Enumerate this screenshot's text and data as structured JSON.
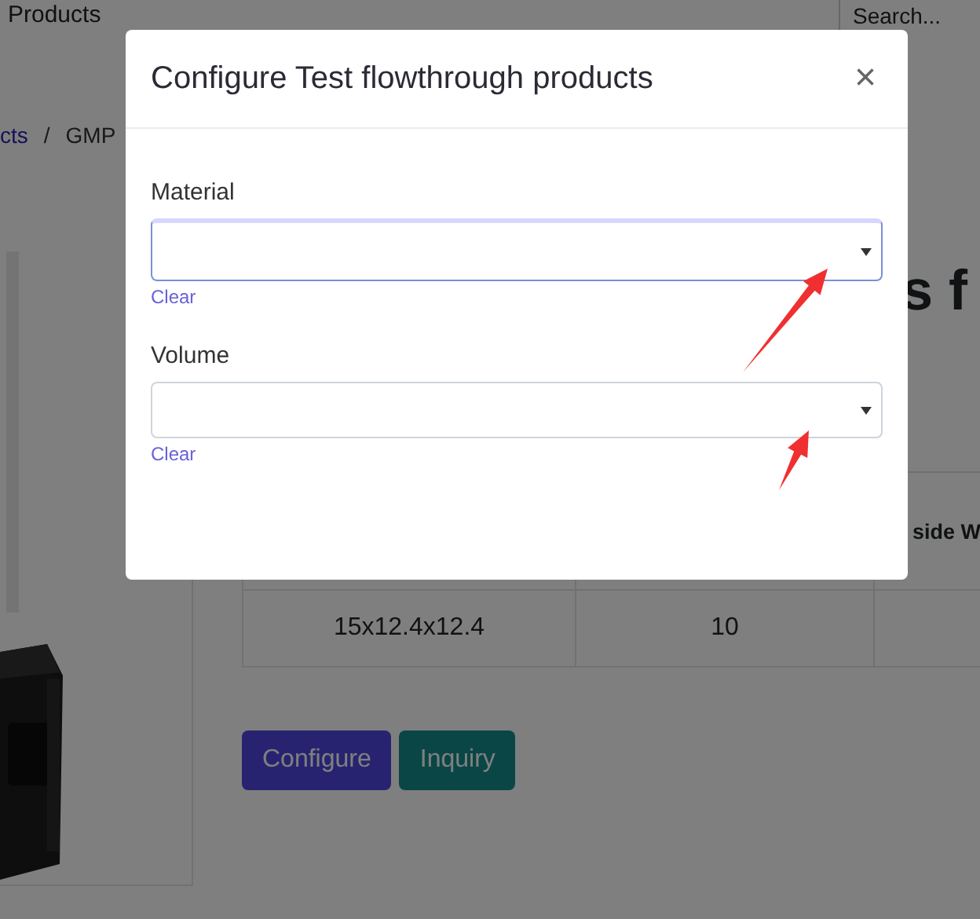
{
  "nav": {
    "items": [
      "Products"
    ],
    "search": {
      "placeholder": "Search..."
    }
  },
  "breadcrumb": {
    "link": "cts",
    "separator": "/",
    "current": "GMP"
  },
  "heading": "s f",
  "table": {
    "header_cell_3": "side W",
    "rows": [
      [
        "15x12.4x12.4",
        "10",
        null
      ]
    ]
  },
  "buttons": [
    {
      "label": "Configure",
      "kind": "primary"
    },
    {
      "label": "Inquiry",
      "kind": "secondary"
    }
  ],
  "modal": {
    "title": "Configure Test flowthrough products",
    "close": "×",
    "fields": [
      {
        "label": "Material",
        "focused": true,
        "clear": "Clear"
      },
      {
        "label": "Volume",
        "focused": false,
        "clear": "Clear"
      }
    ]
  }
}
